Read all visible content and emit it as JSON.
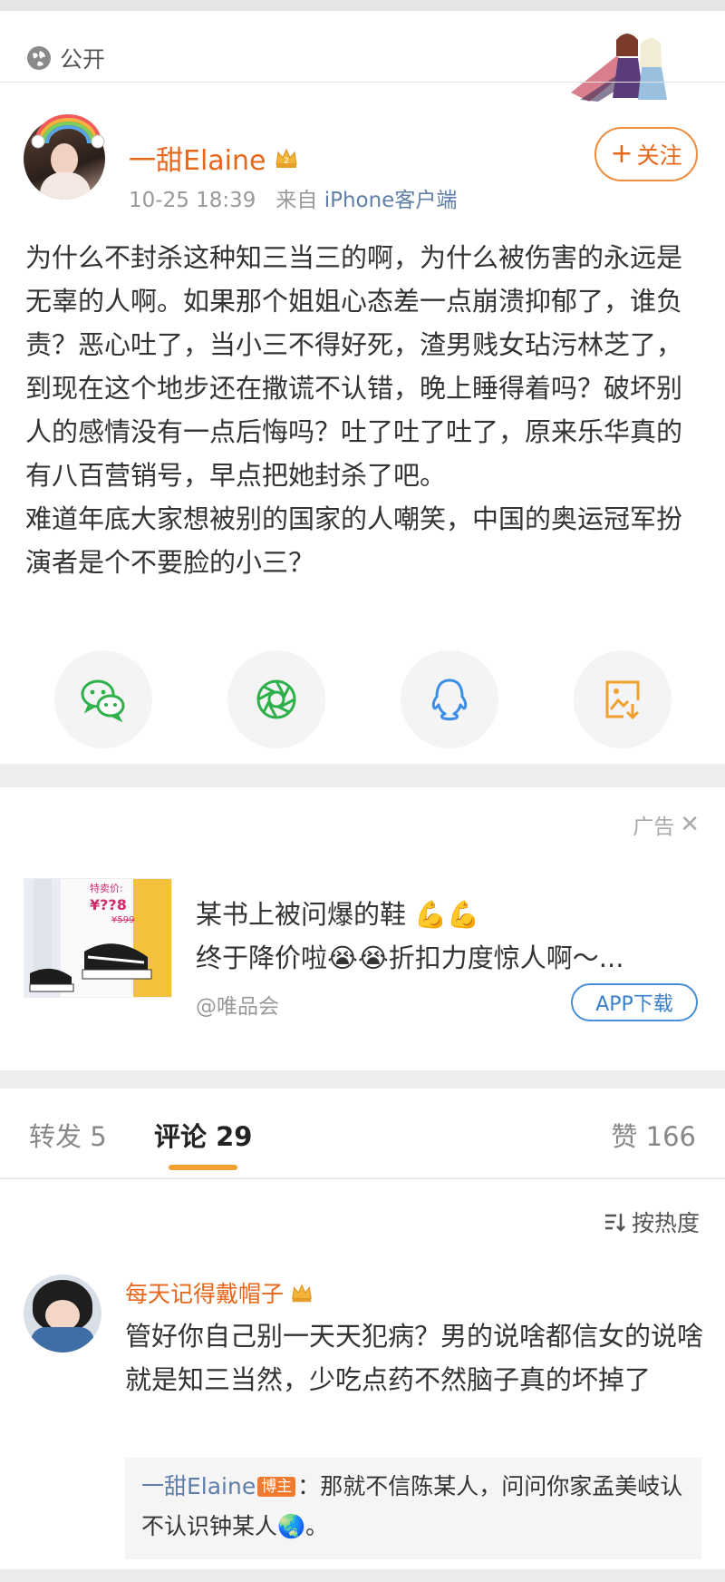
{
  "post": {
    "visibility": "公开",
    "author": "一甜Elaine",
    "time": "10-25 18:39",
    "source_prefix": "来自",
    "source": "iPhone客户端",
    "follow_label": "关注",
    "text": "为什么不封杀这种知三当三的啊，为什么被伤害的永远是无辜的人啊。如果那个姐姐心态差一点崩溃抑郁了，谁负责？恶心吐了，当小三不得好死，渣男贱女玷污林芝了，到现在这个地步还在撒谎不认错，晚上睡得着吗？破坏别人的感情没有一点后悔吗？吐了吐了吐了，原来乐华真的有八百营销号，早点把她封杀了吧。\n难道年底大家想被别的国家的人嘲笑，中国的奥运冠军扮演者是个不要脸的小三？"
  },
  "share": [
    {
      "icon": "wechat-icon",
      "color": "#2fb04a"
    },
    {
      "icon": "moments-icon",
      "color": "#2fb04a"
    },
    {
      "icon": "qq-icon",
      "color": "#3a8ee6"
    },
    {
      "icon": "save-image-icon",
      "color": "#f0a030"
    }
  ],
  "ad": {
    "tag": "广告",
    "title_line1": "某书上被问爆的鞋",
    "title_line2": "终于降价啦",
    "title_line2b": "折扣力度惊人啊～...",
    "image_price_label": "特卖价:",
    "image_price": "¥??8",
    "image_orig_price": "¥599",
    "source": "@唯品会",
    "cta": "APP下载"
  },
  "tabs": {
    "repost": "转发 5",
    "comments": "评论 29",
    "likes": "赞 166"
  },
  "sort_label": "按热度",
  "comment": {
    "author": "每天记得戴帽子",
    "text": "管好你自己别一天天犯病？男的说啥都信女的说啥就是知三当然，少吃点药不然脑子真的坏掉了",
    "reply": {
      "author": "一甜Elaine",
      "badge": "博主",
      "text_part1": "：那就不信陈某人，问问你家孟美岐认不认识钟某人",
      "text_end": "。"
    }
  },
  "colors": {
    "accent_orange": "#e8661a",
    "link_blue": "#5f7fa8",
    "tab_indicator": "#f0a030"
  }
}
